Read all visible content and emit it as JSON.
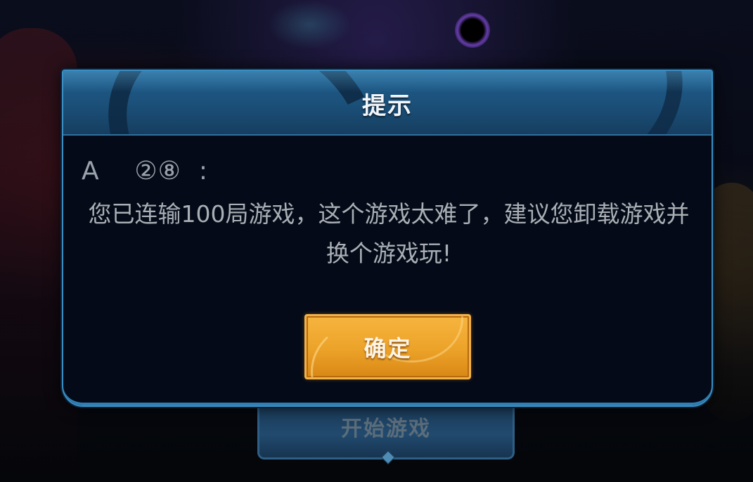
{
  "background": {
    "start_button_label": "开始游戏"
  },
  "dialog": {
    "title": "提示",
    "sender": "A    ②⑧  :",
    "message": "您已连输100局游戏，这个游戏太难了，建议您卸载游戏并换个游戏玩!",
    "confirm_label": "确定"
  },
  "colors": {
    "dialog_border": "#3a8fc4",
    "dialog_header": "#1b4f78",
    "dialog_body": "#040a17",
    "confirm_button": "#eca229",
    "message_text": "#a9afb4"
  }
}
